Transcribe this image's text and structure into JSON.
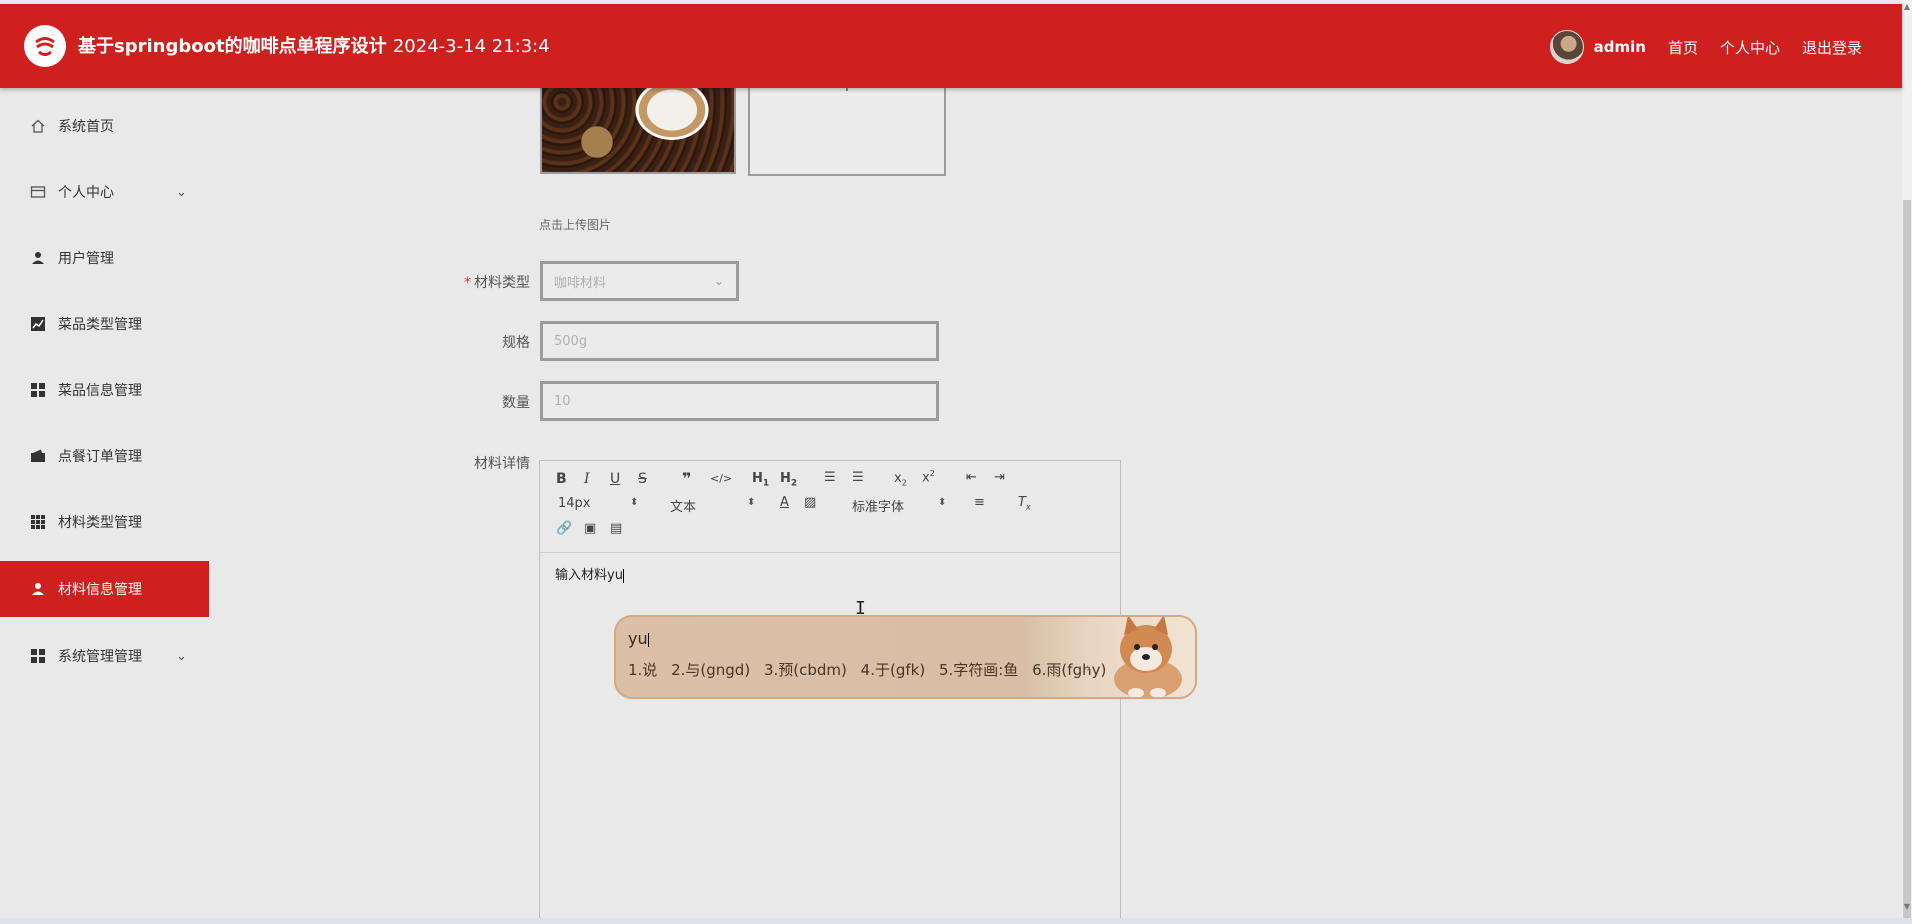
{
  "header": {
    "title": "基于springboot的咖啡点单程序设计",
    "timestamp": "2024-3-14 21:3:4",
    "user": "admin",
    "links": [
      "首页",
      "个人中心",
      "退出登录"
    ]
  },
  "sidebar": {
    "items": [
      {
        "label": "系统首页",
        "icon": "home-icon"
      },
      {
        "label": "个人中心",
        "icon": "card-icon",
        "expandable": true
      },
      {
        "label": "用户管理",
        "icon": "user-icon"
      },
      {
        "label": "菜品类型管理",
        "icon": "chart-icon"
      },
      {
        "label": "菜品信息管理",
        "icon": "grid-icon"
      },
      {
        "label": "点餐订单管理",
        "icon": "wallet-icon"
      },
      {
        "label": "材料类型管理",
        "icon": "grid9-icon"
      },
      {
        "label": "材料信息管理",
        "icon": "user-icon",
        "active": true
      },
      {
        "label": "系统管理管理",
        "icon": "grid-icon",
        "expandable": true
      }
    ]
  },
  "form": {
    "upload_hint": "点击上传图片",
    "material_type": {
      "label": "材料类型",
      "required": true,
      "value": "咖啡材料"
    },
    "spec": {
      "label": "规格",
      "placeholder": "500g"
    },
    "quantity": {
      "label": "数量",
      "placeholder": "10"
    },
    "detail": {
      "label": "材料详情",
      "content": "输入材料yu"
    }
  },
  "editor": {
    "font_size": "14px",
    "text_style": "文本",
    "font_family": "标准字体"
  },
  "ime": {
    "input": "yu",
    "candidates": [
      "1.说",
      "2.与(gngd)",
      "3.预(cbdm)",
      "4.于(gfk)",
      "5.字符画:鱼",
      "6.雨(fghy)"
    ]
  },
  "colors": {
    "brand": "#cf2020",
    "background": "#e9e9e9"
  }
}
